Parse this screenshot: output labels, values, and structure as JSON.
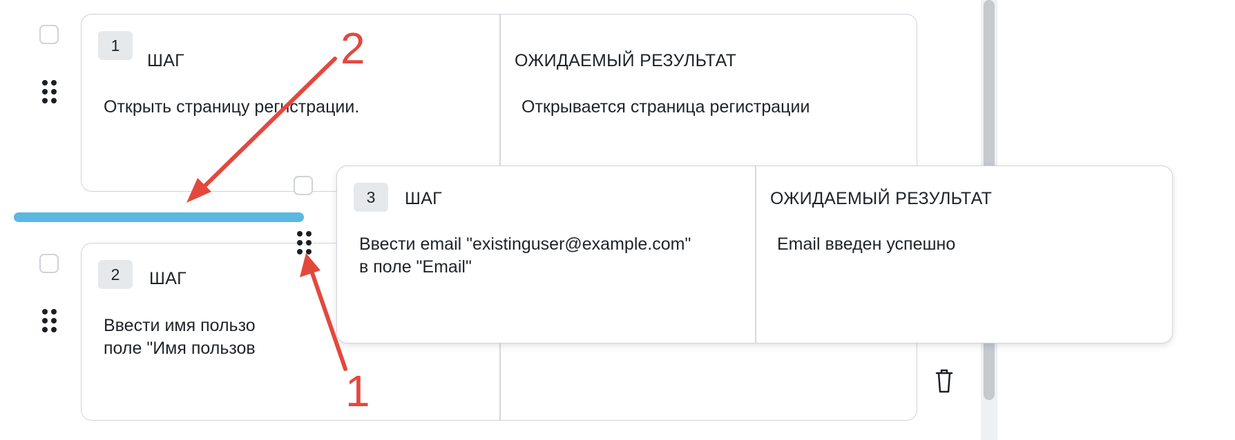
{
  "steps": [
    {
      "number": "1",
      "step_label": "ШАГ",
      "result_label": "ОЖИДАЕМЫЙ РЕЗУЛЬТАТ",
      "step_text": "Открыть страницу регистрации.",
      "result_text": "Открывается страница регистрации"
    },
    {
      "number": "2",
      "step_label": "ШАГ",
      "step_text": "Ввести имя пользо\nполе \"Имя пользов"
    }
  ],
  "dragged_step": {
    "number": "3",
    "step_label": "ШАГ",
    "result_label": "ОЖИДАЕМЫЙ РЕЗУЛЬТАТ",
    "step_text": "Ввести email \"existinguser@example.com\"\nв поле \"Email\"",
    "result_text": "Email введен успешно"
  },
  "annotations": {
    "arrow_1_label": "1",
    "arrow_2_label": "2"
  },
  "colors": {
    "drop_indicator": "#5ab9e0",
    "annotation": "#e3483f",
    "card_border": "#cfd3d8"
  },
  "icons": [
    "drag-handle-icon",
    "trash-icon"
  ]
}
